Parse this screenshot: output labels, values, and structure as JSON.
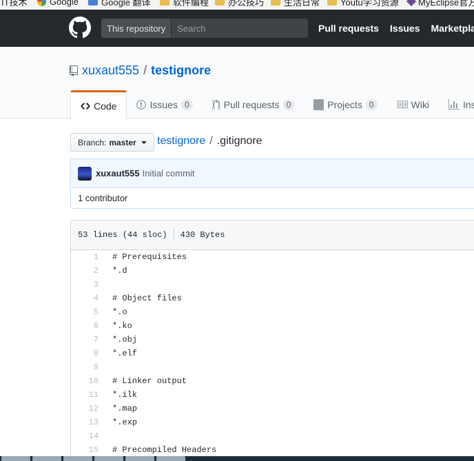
{
  "bookmarks": [
    {
      "label": "IT技术",
      "icon": "folder-icon"
    },
    {
      "label": "Google",
      "icon": "google-icon"
    },
    {
      "label": "Google 翻译",
      "icon": "translate-icon"
    },
    {
      "label": "软件编程",
      "icon": "folder-icon"
    },
    {
      "label": "办公技巧",
      "icon": "folder-icon"
    },
    {
      "label": "生活日常",
      "icon": "folder-icon"
    },
    {
      "label": "Youtu学习资源",
      "icon": "folder-icon"
    },
    {
      "label": "MyEclipse官方",
      "icon": "eclipse-icon"
    }
  ],
  "header": {
    "scope_label": "This repository",
    "search_placeholder": "Search",
    "nav": [
      "Pull requests",
      "Issues",
      "Marketplace"
    ]
  },
  "repo": {
    "owner": "xuxaut555",
    "separator": "/",
    "name": "testignore"
  },
  "tabs": [
    {
      "label": "Code",
      "icon": "code-icon",
      "selected": true
    },
    {
      "label": "Issues",
      "icon": "issue-icon",
      "count": "0"
    },
    {
      "label": "Pull requests",
      "icon": "pull-request-icon",
      "count": "0"
    },
    {
      "label": "Projects",
      "icon": "project-icon",
      "count": "0"
    },
    {
      "label": "Wiki",
      "icon": "book-icon"
    },
    {
      "label": "Insights",
      "icon": "graph-icon"
    }
  ],
  "branch": {
    "prefix": "Branch:",
    "name": "master"
  },
  "breadcrumb": {
    "repo": "testignore",
    "separator": "/",
    "file": ".gitignore"
  },
  "commit": {
    "author": "xuxaut555",
    "message": "Initial commit",
    "contributors": "1 contributor"
  },
  "file": {
    "lines_info": "53 lines (44 sloc)",
    "size": "430 Bytes",
    "lines": [
      {
        "n": "1",
        "text": "# Prerequisites"
      },
      {
        "n": "2",
        "text": "*.d"
      },
      {
        "n": "3",
        "text": ""
      },
      {
        "n": "4",
        "text": "# Object files"
      },
      {
        "n": "5",
        "text": "*.o"
      },
      {
        "n": "6",
        "text": "*.ko"
      },
      {
        "n": "7",
        "text": "*.obj"
      },
      {
        "n": "8",
        "text": "*.elf"
      },
      {
        "n": "9",
        "text": ""
      },
      {
        "n": "10",
        "text": "# Linker output"
      },
      {
        "n": "11",
        "text": "*.ilk"
      },
      {
        "n": "12",
        "text": "*.map"
      },
      {
        "n": "13",
        "text": "*.exp"
      },
      {
        "n": "14",
        "text": ""
      },
      {
        "n": "15",
        "text": "# Precompiled Headers"
      }
    ]
  },
  "colors": {
    "header_bg": "#24292e",
    "link": "#0366d6",
    "tab_accent": "#e36209"
  }
}
